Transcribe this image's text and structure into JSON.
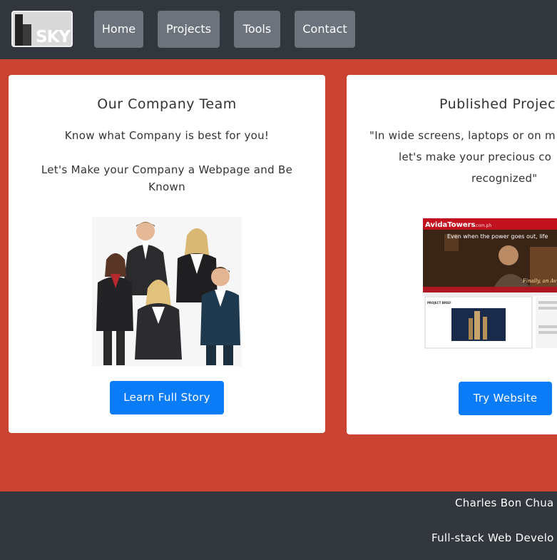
{
  "nav": {
    "logo_text": "SKY",
    "items": [
      {
        "label": "Home"
      },
      {
        "label": "Projects"
      },
      {
        "label": "Tools"
      },
      {
        "label": "Contact"
      }
    ]
  },
  "cards": [
    {
      "title": "Our Company Team",
      "lines": [
        "Know what Company is best for you!",
        "Let's Make your Company a Webpage and Be Known"
      ],
      "button": "Learn Full Story",
      "image_desc": "team-photo"
    },
    {
      "title": "Published Projec",
      "lines": [
        "\"In wide screens, laptops or on m",
        "let's make your precious co",
        "recognized\""
      ],
      "button": "Try Website",
      "image": {
        "brand": "AvidaTowers",
        "brand_suffix": ".com.ph",
        "tagline": "Even when the power goes out, life",
        "tagline2": "Finally, an Av",
        "section": "PROJECT BRIEF"
      }
    }
  ],
  "footer": {
    "name": "Charles Bon Chua",
    "role": "Full-stack Web Develo"
  },
  "colors": {
    "nav_bg": "#32363d",
    "nav_button": "#6c737c",
    "page_bg": "#c94232",
    "primary_button": "#0a7cf8"
  }
}
